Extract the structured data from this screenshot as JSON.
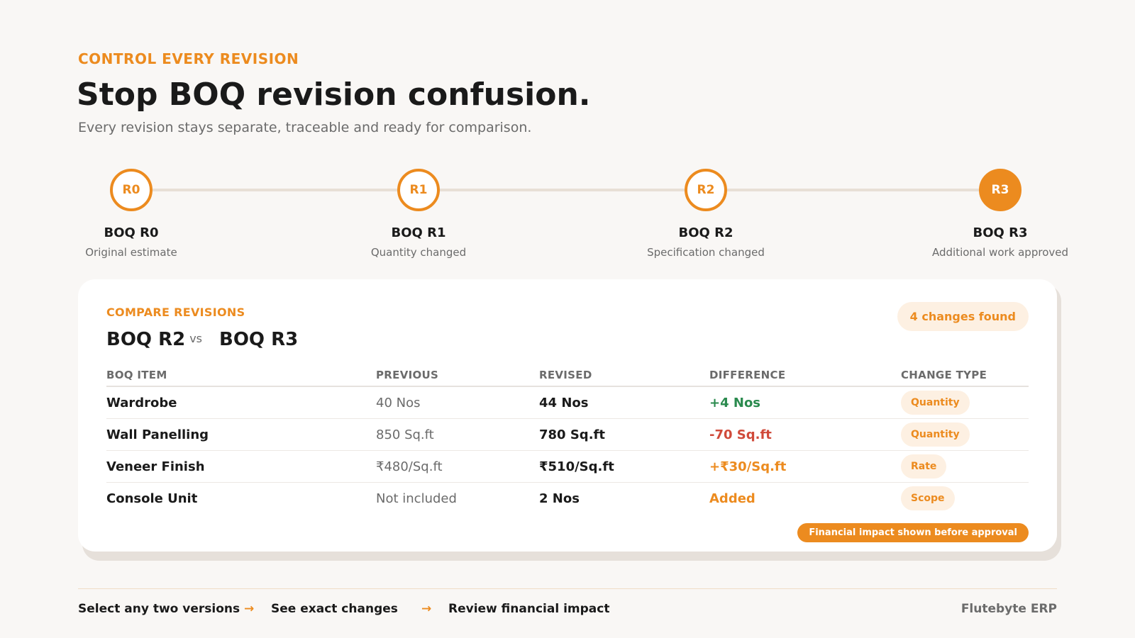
{
  "header": {
    "eyebrow": "CONTROL EVERY REVISION",
    "title": "Stop BOQ revision confusion.",
    "subtitle": "Every revision stays separate, traceable and ready for comparison."
  },
  "timeline": [
    {
      "badge": "R0",
      "label": "BOQ R0",
      "desc": "Original estimate",
      "active": false
    },
    {
      "badge": "R1",
      "label": "BOQ R1",
      "desc": "Quantity changed",
      "active": false
    },
    {
      "badge": "R2",
      "label": "BOQ R2",
      "desc": "Specification changed",
      "active": false
    },
    {
      "badge": "R3",
      "label": "BOQ R3",
      "desc": "Additional work approved",
      "active": true
    }
  ],
  "compare": {
    "eyebrow": "COMPARE REVISIONS",
    "left": "BOQ R2",
    "vs": "vs",
    "right": "BOQ R3",
    "badge": "4 changes found",
    "columns": [
      "BOQ ITEM",
      "PREVIOUS",
      "REVISED",
      "DIFFERENCE",
      "CHANGE TYPE"
    ],
    "rows": [
      {
        "item": "Wardrobe",
        "previous": "40 Nos",
        "revised": "44 Nos",
        "difference": "+4 Nos",
        "tone": "green",
        "type": "Quantity"
      },
      {
        "item": "Wall Panelling",
        "previous": "850 Sq.ft",
        "revised": "780 Sq.ft",
        "difference": "-70 Sq.ft",
        "tone": "red",
        "type": "Quantity"
      },
      {
        "item": "Veneer Finish",
        "previous": "₹480/Sq.ft",
        "revised": "₹510/Sq.ft",
        "difference": "+₹30/Sq.ft",
        "tone": "orange",
        "type": "Rate"
      },
      {
        "item": "Console Unit",
        "previous": "Not included",
        "revised": "2 Nos",
        "difference": "Added",
        "tone": "orange",
        "type": "Scope"
      }
    ],
    "impact": "Financial impact shown before approval"
  },
  "footer": {
    "steps": [
      "Select any two versions",
      "See exact changes",
      "Review financial impact"
    ],
    "arrow": "→",
    "brand": "Flutebyte ERP"
  },
  "colors": {
    "accent": "#ec8b1f",
    "positive": "#2a8a4e",
    "negative": "#d04a3a"
  }
}
